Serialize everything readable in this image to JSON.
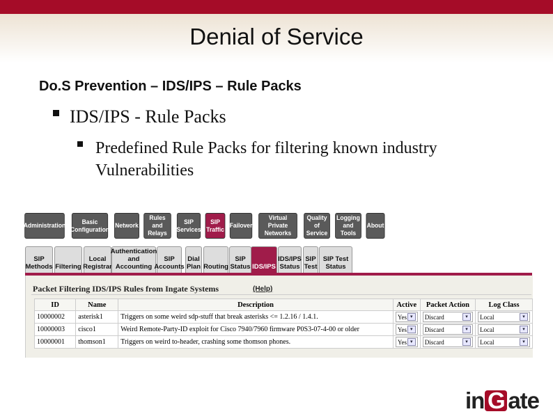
{
  "slide": {
    "title": "Denial of Service",
    "subtitle": "Do.S Prevention – IDS/IPS – Rule Packs",
    "bullet1": "IDS/IPS - Rule Packs",
    "bullet2": "Predefined Rule Packs for filtering known industry Vulnerabilities"
  },
  "nav": {
    "items": [
      "Administration",
      "Basic Configuration",
      "Network",
      "Rules and Relays",
      "SIP Services",
      "SIP Traffic",
      "Failover",
      "Virtual Private Networks",
      "Quality of Service",
      "Logging and Tools",
      "About"
    ],
    "active": "SIP Traffic"
  },
  "subtabs": {
    "items": [
      "SIP Methods",
      "Filtering",
      "Local Registrar",
      "Authentication and Accounting",
      "SIP Accounts",
      "Dial Plan",
      "Routing",
      "SIP Status",
      "IDS/IPS",
      "IDS/IPS Status",
      "SIP Test",
      "SIP Test Status"
    ],
    "active": "IDS/IPS"
  },
  "panel": {
    "title": "Packet Filtering IDS/IPS Rules from Ingate Systems",
    "help": "(Help)"
  },
  "table": {
    "headers": [
      "ID",
      "Name",
      "Description",
      "Active",
      "Packet Action",
      "Log Class"
    ],
    "rows": [
      {
        "id": "10000002",
        "name": "asterisk1",
        "description": "Triggers on some weird sdp-stuff that break asterisks <= 1.2.16 / 1.4.1.",
        "active": "Yes",
        "action": "Discard",
        "log": "Local"
      },
      {
        "id": "10000003",
        "name": "cisco1",
        "description": "Weird Remote-Party-ID exploit for Cisco 7940/7960 firmware P0S3-07-4-00 or older",
        "active": "Yes",
        "action": "Discard",
        "log": "Local"
      },
      {
        "id": "10000001",
        "name": "thomson1",
        "description": "Triggers on weird to-header, crashing some thomson phones.",
        "active": "Yes",
        "action": "Discard",
        "log": "Local"
      }
    ]
  },
  "logo": {
    "text_left": "in",
    "text_box": "G",
    "text_right": "ate"
  },
  "colors": {
    "brand": "#a50c28",
    "active_tab": "#a01c4a"
  }
}
